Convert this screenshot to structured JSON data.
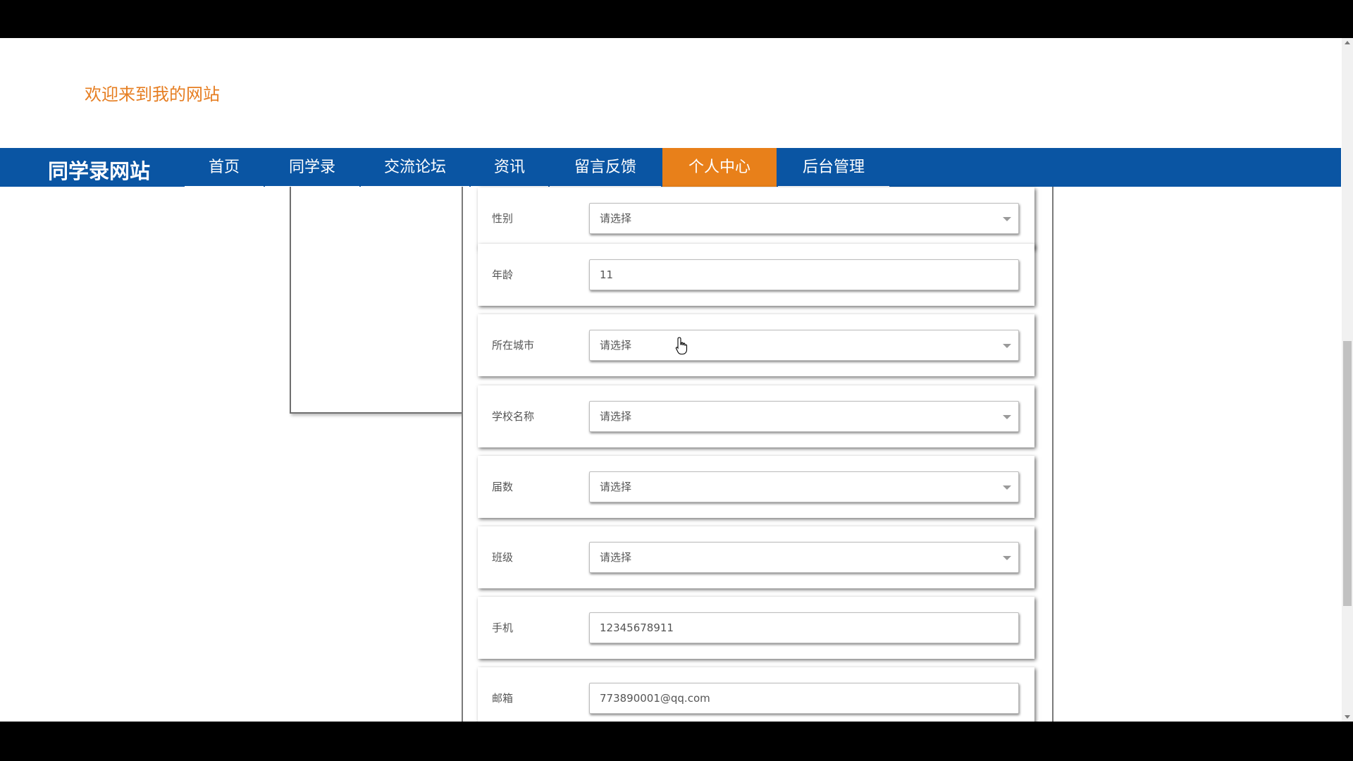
{
  "header": {
    "welcome": "欢迎来到我的网站"
  },
  "nav": {
    "brand": "同学录网站",
    "items": [
      {
        "label": "首页"
      },
      {
        "label": "同学录"
      },
      {
        "label": "交流论坛"
      },
      {
        "label": "资讯"
      },
      {
        "label": "留言反馈"
      },
      {
        "label": "个人中心",
        "active": true
      },
      {
        "label": "后台管理"
      }
    ]
  },
  "form": {
    "fields": [
      {
        "label": "性别",
        "type": "select",
        "value": "请选择"
      },
      {
        "label": "年龄",
        "type": "input",
        "value": "11"
      },
      {
        "label": "所在城市",
        "type": "select",
        "value": "请选择"
      },
      {
        "label": "学校名称",
        "type": "select",
        "value": "请选择"
      },
      {
        "label": "届数",
        "type": "select",
        "value": "请选择"
      },
      {
        "label": "班级",
        "type": "select",
        "value": "请选择"
      },
      {
        "label": "手机",
        "type": "input",
        "value": "12345678911"
      },
      {
        "label": "邮箱",
        "type": "input",
        "value": "773890001@qq.com"
      }
    ]
  },
  "colors": {
    "nav_bg": "#0a55a3",
    "accent": "#e8801a",
    "welcome_text": "#e67e22"
  }
}
